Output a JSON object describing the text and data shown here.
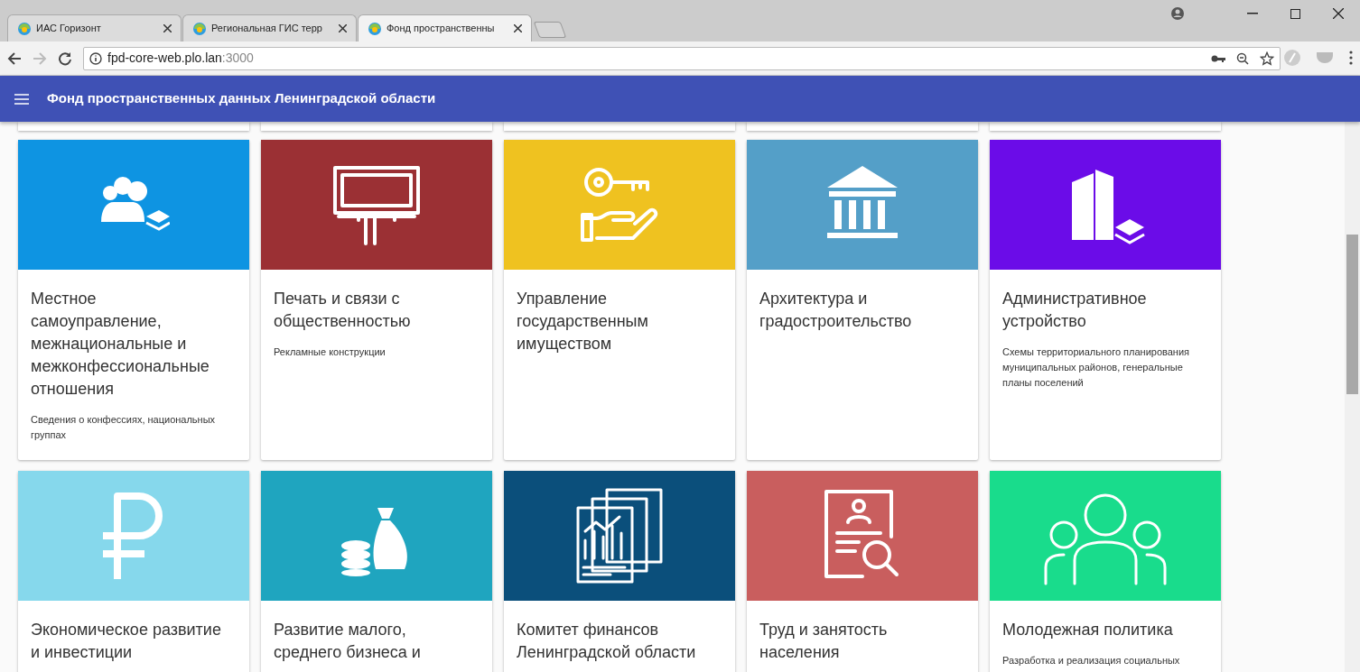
{
  "browser": {
    "tabs": [
      {
        "title": "ИАС Горизонт",
        "selected": false
      },
      {
        "title": "Региональная ГИС терр",
        "selected": false
      },
      {
        "title": "Фонд пространственны",
        "selected": true
      }
    ],
    "address": {
      "host": "fpd-core-web.plo.lan",
      "port": ":3000"
    }
  },
  "app_bar": {
    "title": "Фонд пространственных данных Ленинградской области"
  },
  "cards": [
    {
      "title": "Местное самоуправление, межнациональные и межконфессиональные отношения",
      "description": "Сведения о конфессиях, национальных группах",
      "color": "#0e94e2"
    },
    {
      "title": "Печать и связи с общественностью",
      "description": "Рекламные конструкции",
      "color": "#9b3034"
    },
    {
      "title": "Управление государственным имуществом",
      "color": "#efc220"
    },
    {
      "title": "Архитектура и градостроительство",
      "color": "#549fc8"
    },
    {
      "title": "Административное устройство",
      "description": "Схемы территориального планирования муниципальных районов, генеральные планы поселений",
      "color": "#6b0ce8"
    },
    {
      "title": "Экономическое развитие и инвестиции",
      "color": "#86d8ec"
    },
    {
      "title": "Развитие малого, среднего бизнеса и",
      "color": "#1fa5bf"
    },
    {
      "title": "Комитет финансов Ленинградской области",
      "color": "#0b4f7b"
    },
    {
      "title": "Труд и занятость населения",
      "color": "#c95e5e"
    },
    {
      "title": "Молодежная политика",
      "description": "Разработка и реализация социальных",
      "color": "#19dc8c"
    }
  ]
}
